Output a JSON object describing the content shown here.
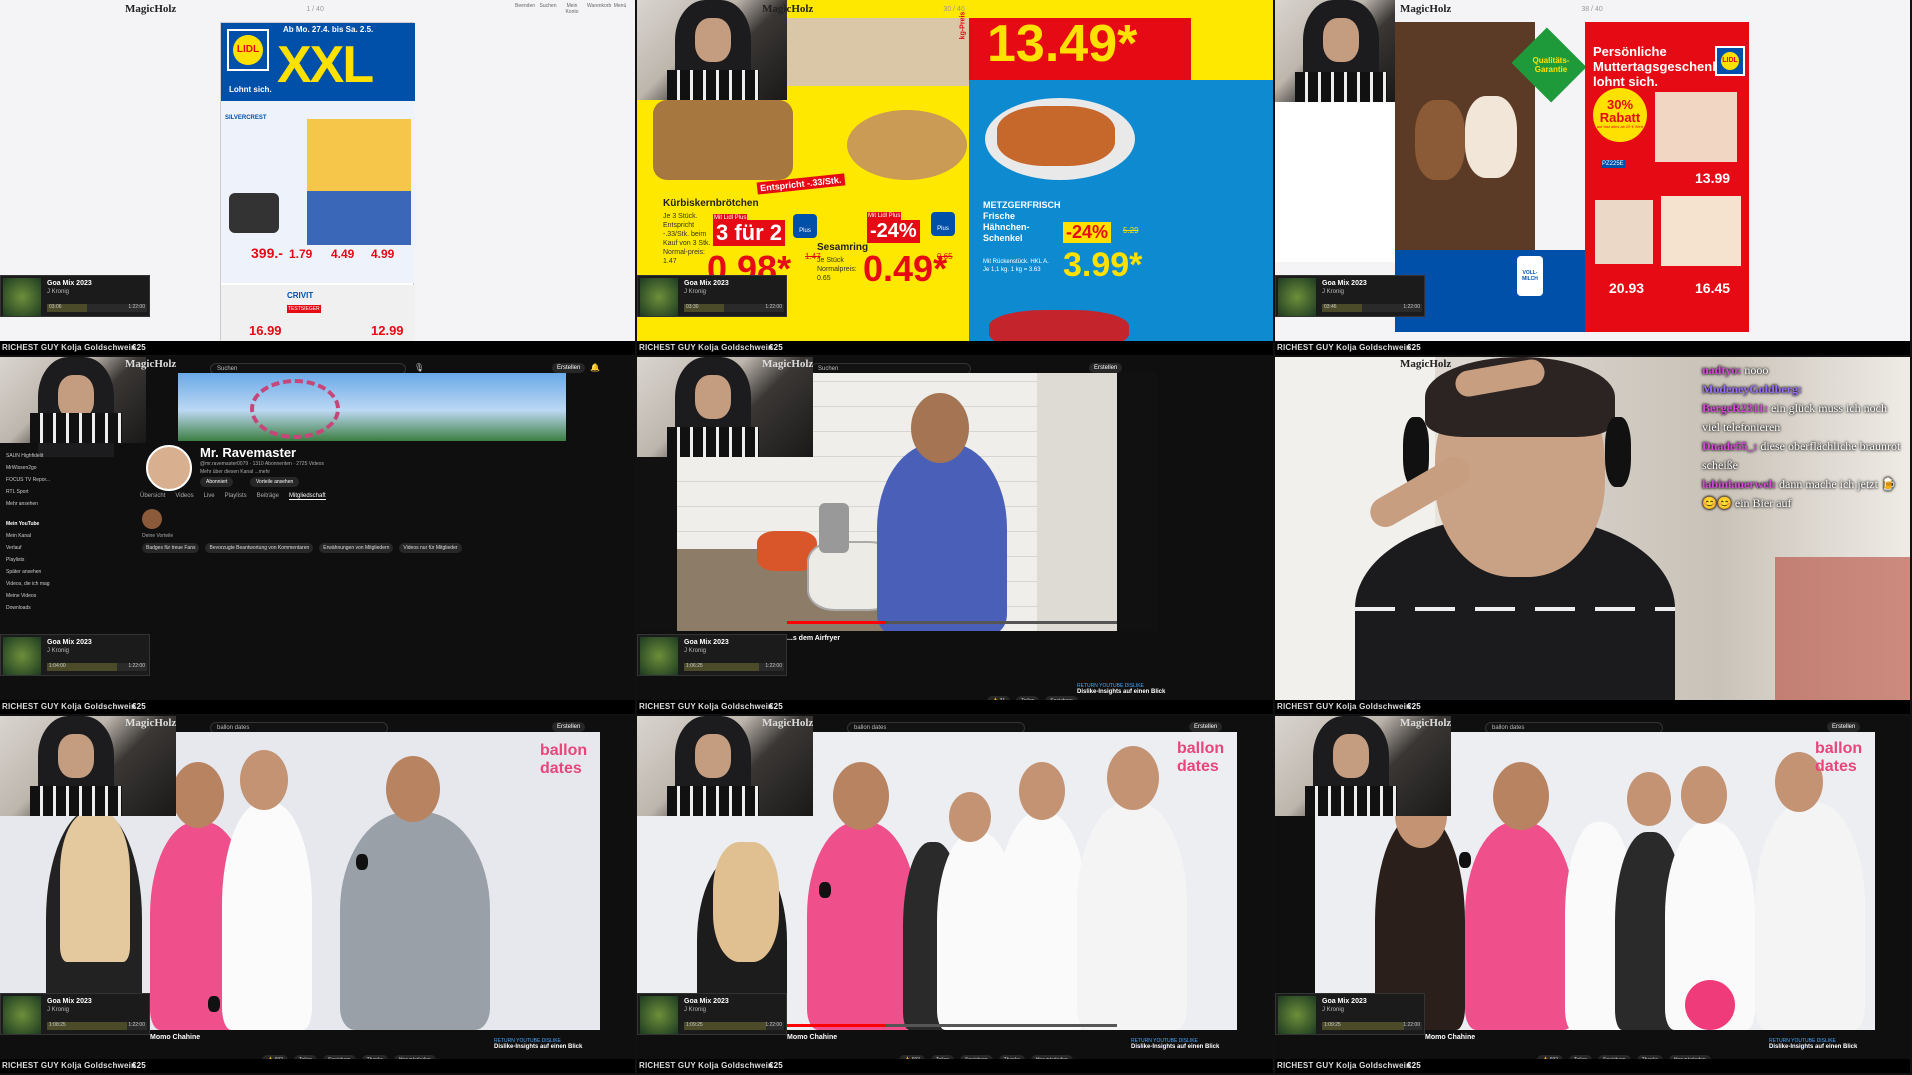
{
  "common": {
    "brand": "MagicHolz",
    "ticker": "RICHEST GUY Kolja Goldschwein",
    "ticker_cost": "€25",
    "music_title": "Goa Mix 2023",
    "music_artist": "J Kronig"
  },
  "panels": [
    {
      "id": "p1",
      "type": "lidl-flyer-1",
      "flyer_date": "Ab Mo. 27.4. bis Sa. 2.5.",
      "headline": "XXL",
      "slogan": "Lohnt sich.",
      "brand": "LIDL",
      "prices": [
        "399.-",
        "1.79",
        "4.49",
        "4.99",
        "16.99",
        "12.99"
      ],
      "labels": [
        "SILVERCREST",
        "CRIVIT",
        "TESTSIEGER"
      ],
      "music_left": "03:06",
      "music_right": "1:22:00",
      "nav": [
        "Beenden",
        "Suchen",
        "Mein Konto",
        "Warenkorb",
        "Menü"
      ],
      "top_mid": "1 / 40"
    },
    {
      "id": "p2",
      "type": "lidl-flyer-2",
      "kg_price": "13.49*",
      "kg_label": "kg-Preis",
      "items": [
        {
          "name": "Kürbiskernbrötchen",
          "deal": "3 für 2",
          "price": "0.98*",
          "old": "1.47",
          "note": "Entspricht -.33/Stk.",
          "desc": "Je 3 Stück. Entspricht -.33/Stk. beim Kauf von 3 Stk. Normal-preis: 1.47"
        },
        {
          "name": "Sesamring",
          "deal": "-24%",
          "price": "0.49*",
          "old": "0.65",
          "desc": "Je Stück Normalpreis: 0.65"
        },
        {
          "name": "METZGERFRISCH Frische Hähnchen-Schenkel",
          "deal": "-24%",
          "price": "3.99*",
          "old": "5.29",
          "desc": "Mit Rückenstück. HKL A. Je 1,1 kg. 1 kg = 3.63"
        }
      ],
      "plus_label": "Mit Lidl Plus",
      "plus": "Plus",
      "music_left": "03:30",
      "music_right": "1:22:00",
      "top_mid": "30 / 40"
    },
    {
      "id": "p3",
      "type": "lidl-flyer-3",
      "headline": "Persönliche Muttertagsgeschenke lohnt sich.",
      "badge": "30% Rabatt",
      "badge_sub": "auf fast alles ab 20 € Wert",
      "quality": "Qualitäts-Garantie",
      "code": "PZ225E",
      "prices": [
        "13.99",
        "20.93",
        "16.45"
      ],
      "milk": "VOLL-MILCH",
      "music_left": "03:46",
      "music_right": "1:22:00",
      "top_mid": "38 / 40"
    },
    {
      "id": "p4",
      "type": "youtube-channel",
      "search_placeholder": "Suchen",
      "channel_name": "Mr. Ravemaster",
      "channel_meta": "@mr.ravemaster0079 · 1310 Abonnenten · 2725 Videos",
      "channel_desc": "Mehr über diesen Kanal ...mehr",
      "subscribe": "Abonniert",
      "perks": "Vorteile ansehen",
      "tabs": [
        "Übersicht",
        "Videos",
        "Live",
        "Playlists",
        "Beiträge",
        "Mitgliedschaft"
      ],
      "side_items": [
        "SAUN Highfidelit",
        "MrWissen2go",
        "FOCUS TV Repor...",
        "RTL Sport",
        "Mehr ansehen"
      ],
      "my_youtube": "Mein YouTube",
      "my_items": [
        "Mein Kanal",
        "Verlauf",
        "Playlists",
        "Später ansehen",
        "Videos, die ich mag",
        "Meine Videos",
        "Downloads"
      ],
      "member_badges": "Deine Vorteile",
      "member_perks": [
        "Badges für treue Fans",
        "Bevorzugte Beantwortung von Kommentaren",
        "Erwähnungen von Mitgliedern",
        "Videos nur für Mitglieder"
      ],
      "create": "Erstellen",
      "music_left": "1:04:00",
      "music_right": "1:22:00"
    },
    {
      "id": "p5",
      "type": "youtube-video-kitchen",
      "search_placeholder": "Suchen",
      "video_title": "...s dem Airfryer",
      "likes": "31",
      "share": "Teilen",
      "save": "Speichern",
      "ad_label": "RETURN YOUTUBE DISLIKE",
      "ad_title": "Dislike-Insights auf einen Blick",
      "create": "Erstellen",
      "music_left": "1:06:25",
      "music_right": "1:22:00"
    },
    {
      "id": "p6",
      "type": "webcam-chat",
      "chat": [
        {
          "user": "nadtyo:",
          "msg": "nooo"
        },
        {
          "user": "ModeneyGoldberg:",
          "msg": ""
        },
        {
          "user": "BergeR2311:",
          "msg": "ein glück muss ich noch viel telefonieren"
        },
        {
          "user": "Dnade55_:",
          "msg": "diese oberflächliche braunrot scheiße"
        },
        {
          "user": "labinlauerwel:",
          "msg": "dann mache ich jetzt 🍺😊😊 ein Bier auf"
        }
      ]
    },
    {
      "id": "p7",
      "type": "youtube-ballon",
      "search_value": "ballon dates",
      "channel": "Momo Chahine",
      "likes": "692",
      "share": "Teilen",
      "save": "Speichern",
      "thanks": "Thanks",
      "download": "Herunterladen",
      "ad_label": "RETURN YOUTUBE DISLIKE",
      "ad_title": "Dislike-Insights auf einen Blick",
      "brand_logo": "ballon dates",
      "create": "Erstellen",
      "music_left": "1:08:25",
      "music_right": "1:22:00"
    },
    {
      "id": "p8",
      "type": "youtube-ballon",
      "search_value": "ballon dates",
      "channel": "Momo Chahine",
      "likes": "692",
      "share": "Teilen",
      "save": "Speichern",
      "thanks": "Thanks",
      "download": "Herunterladen",
      "ad_label": "RETURN YOUTUBE DISLIKE",
      "ad_title": "Dislike-Insights auf einen Blick",
      "brand_logo": "ballon dates",
      "create": "Erstellen",
      "music_left": "1:09:25",
      "music_right": "1:22:00"
    },
    {
      "id": "p9",
      "type": "youtube-ballon",
      "search_value": "ballon dates",
      "channel": "Momo Chahine",
      "likes": "692",
      "share": "Teilen",
      "save": "Speichern",
      "thanks": "Thanks",
      "download": "Herunterladen",
      "ad_label": "RETURN YOUTUBE DISLIKE",
      "ad_title": "Dislike-Insights auf einen Blick",
      "brand_logo": "ballon dates",
      "create": "Erstellen",
      "music_left": "1:09:25",
      "music_right": "1:22:00"
    }
  ],
  "colors": {
    "lidl_blue": "#0050aa",
    "lidl_yellow": "#ffe100",
    "lidl_red": "#e60a14",
    "yt_dark": "#0f0f0f",
    "ballon_pink": "#e8457a"
  }
}
